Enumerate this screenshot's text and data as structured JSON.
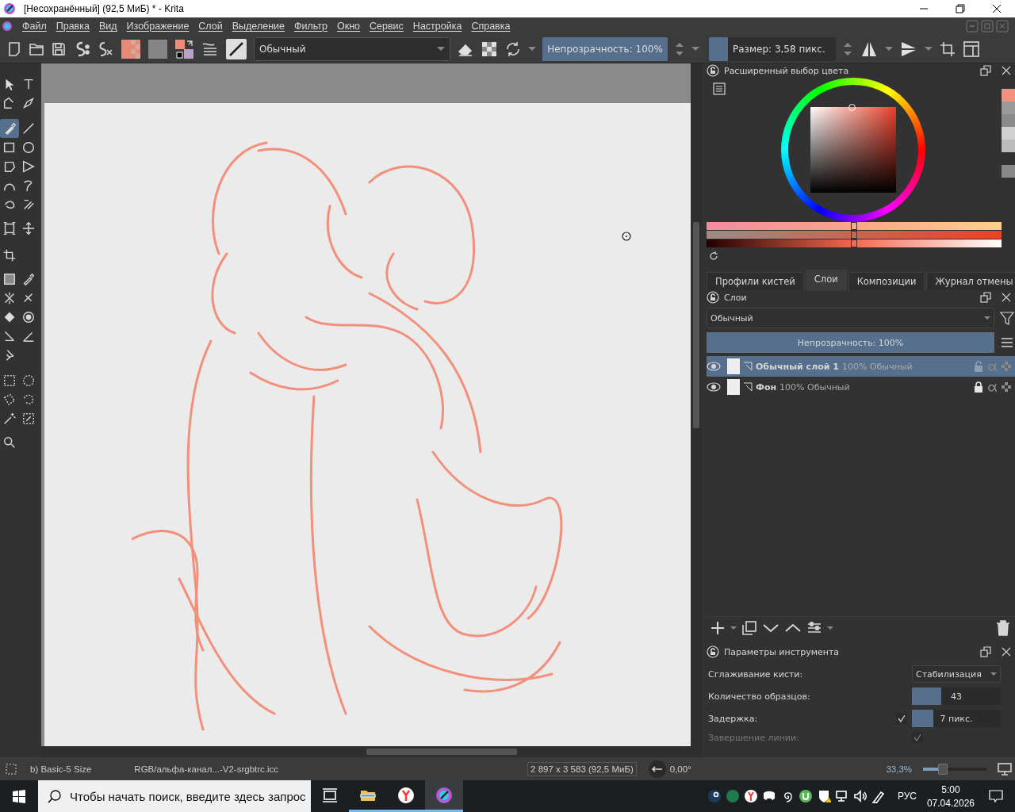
{
  "window": {
    "title": "[Несохранённый]  (92,5 МиБ) * - Krita"
  },
  "menu": [
    "Файл",
    "Правка",
    "Вид",
    "Изображение",
    "Слой",
    "Выделение",
    "Фильтр",
    "Окно",
    "Сервис",
    "Настройка",
    "Справка"
  ],
  "toolbar": {
    "blend_mode": "Обычный",
    "opacity": {
      "text": "Непрозрачность: 100%",
      "level": 1
    },
    "size": {
      "text": "Размер: 3,58 пикс.",
      "level": 0.15
    }
  },
  "tools": [
    {
      "selected": false
    },
    {
      "selected": false
    },
    {
      "selected": false
    },
    {
      "selected": false
    },
    {
      "selected": true
    },
    {
      "selected": false
    },
    {
      "selected": false
    },
    {
      "selected": false
    },
    {
      "selected": false
    },
    {
      "selected": false
    },
    {
      "selected": false
    },
    {
      "selected": false
    },
    {
      "selected": false
    },
    {
      "selected": false
    },
    {
      "selected": false
    },
    {
      "selected": false
    },
    {
      "selected": false
    },
    {
      "selected": false
    },
    {
      "selected": false
    },
    {
      "selected": false
    },
    {
      "selected": false
    },
    {
      "selected": false
    },
    {
      "selected": false
    },
    {
      "selected": false
    },
    {
      "selected": false
    },
    {
      "selected": false
    },
    {
      "selected": false
    },
    {
      "selected": false
    },
    {
      "selected": false
    },
    {
      "selected": false
    },
    {
      "selected": false
    },
    {
      "selected": false
    },
    {
      "selected": false
    }
  ],
  "color_selector": {
    "title": "Расширенный выбор цвета",
    "sliders": [
      {
        "kind": "hue",
        "level": 0.5
      },
      {
        "kind": "saturation",
        "level": 0.5
      },
      {
        "kind": "value",
        "level": 0.5
      }
    ]
  },
  "docker_tabs": [
    {
      "label": "Профили кистей",
      "selected": false
    },
    {
      "label": "Слои",
      "selected": true
    },
    {
      "label": "Композиции",
      "selected": false
    },
    {
      "label": "Журнал отмены",
      "selected": false
    }
  ],
  "layers": {
    "title": "Слои",
    "blend_mode": "Обычный",
    "opacity": {
      "text": "Непрозрачность:  100%",
      "level": 1
    },
    "items": [
      {
        "name": "Обычный слой 1",
        "info": "100% Обычный",
        "selected": true,
        "visible": true,
        "locked": false
      },
      {
        "name": "Фон",
        "info": "100% Обычный",
        "selected": false,
        "visible": true,
        "locked": true
      }
    ]
  },
  "tool_options": {
    "title": "Параметры инструмента",
    "rows": [
      {
        "kind": "select",
        "label": "Сглаживание кисти:",
        "value": "Стабилизация"
      },
      {
        "kind": "spin",
        "label": "Количество образцов:",
        "value": "43",
        "level": 0.33
      },
      {
        "kind": "spin",
        "label": "Задержка:",
        "value": "7 пикс.",
        "level": 0.24,
        "checked": true
      },
      {
        "kind": "check",
        "label": "Завершение линии:",
        "checked": true,
        "disabled": true
      }
    ]
  },
  "status_bar": {
    "brush": "b) Basic-5 Size",
    "color_profile": "RGB/альфа-канал...-V2-srgbtrc.icc",
    "dimensions": "2 897 x 3 583 (92,5 МиБ)",
    "rotation": "0,00°",
    "zoom": {
      "text": "33,3%",
      "level": 0.28
    }
  },
  "taskbar": {
    "search_placeholder": "Чтобы начать поиск, введите здесь запрос",
    "apps": [
      {
        "running": false,
        "selected": false
      },
      {
        "running": true,
        "selected": false
      },
      {
        "running": true,
        "selected": false
      },
      {
        "running": true,
        "selected": true
      }
    ],
    "language": "РУС",
    "time": "5:00",
    "date": "07.04.2026"
  }
}
